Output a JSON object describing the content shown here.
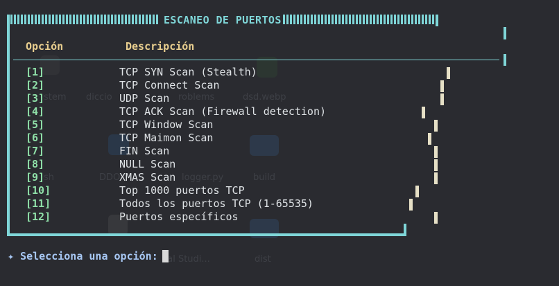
{
  "window": {
    "title": "ESCANEO DE PUERTOS"
  },
  "table": {
    "headers": {
      "option": "Opción",
      "description": "Descripción"
    },
    "rows": [
      {
        "num": "[1]",
        "label": "TCP SYN Scan (Stealth)"
      },
      {
        "num": "[2]",
        "label": "TCP Connect Scan"
      },
      {
        "num": "[3]",
        "label": "UDP Scan"
      },
      {
        "num": "[4]",
        "label": "TCP ACK Scan (Firewall detection)"
      },
      {
        "num": "[5]",
        "label": "TCP Window Scan"
      },
      {
        "num": "[6]",
        "label": "TCP Maimon Scan"
      },
      {
        "num": "[7]",
        "label": "FIN Scan"
      },
      {
        "num": "[8]",
        "label": "NULL Scan"
      },
      {
        "num": "[9]",
        "label": "XMAS Scan"
      },
      {
        "num": "[10]",
        "label": "Top 1000 puertos TCP"
      },
      {
        "num": "[11]",
        "label": "Todos los puertos TCP (1-65535)"
      },
      {
        "num": "[12]",
        "label": "Puertos específicos"
      }
    ]
  },
  "prompt": {
    "text": "✦ Selecciona una opción: "
  },
  "desktop_bg": {
    "items": [
      "stem",
      "diccio",
      "roblems",
      "dsd.webp",
      "sh",
      "DDO",
      "logger.py",
      "build",
      "ual Studi...",
      "dist"
    ]
  },
  "colors": {
    "frame": "#7fd6d8",
    "header": "#e9cf8f",
    "option_number": "#8fe0a8",
    "text": "#dfe3e6",
    "prompt": "#a7c7f3",
    "background": "#2a2b30"
  }
}
